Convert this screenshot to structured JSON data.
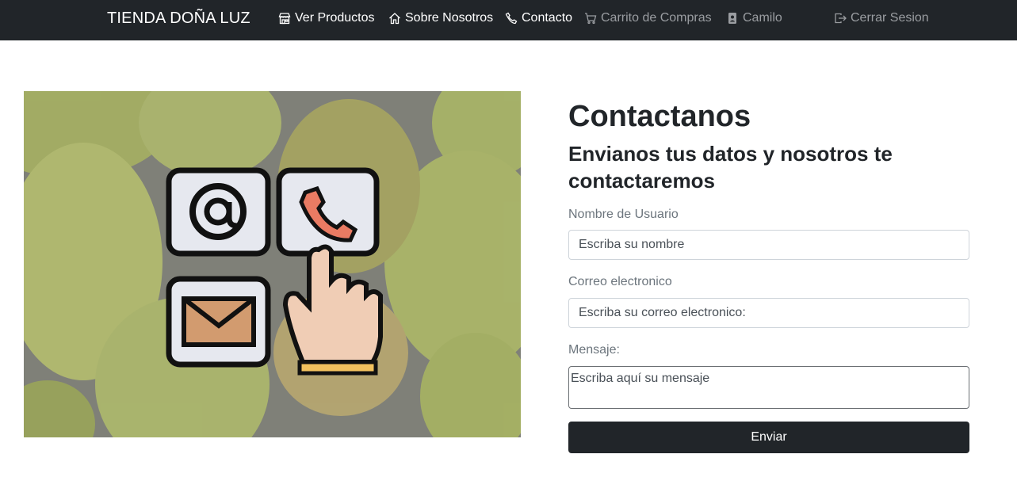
{
  "navbar": {
    "brand": "TIENDA DOÑA LUZ",
    "items": [
      {
        "label": "Ver Productos",
        "icon": "store-icon"
      },
      {
        "label": "Sobre Nosotros",
        "icon": "house-icon"
      },
      {
        "label": "Contacto",
        "icon": "phone-icon"
      },
      {
        "label": "Carrito de Compras",
        "icon": "cart-icon"
      },
      {
        "label": "Camilo",
        "icon": "person-badge-icon"
      },
      {
        "label": "Cerrar Sesion",
        "icon": "logout-icon"
      }
    ],
    "bg_color": "#212529",
    "muted_color": "#9a9da1"
  },
  "hero": {
    "icons": [
      "at-sign-icon",
      "phone-icon",
      "envelope-icon",
      "pointing-hand-icon"
    ]
  },
  "contact": {
    "title": "Contactanos",
    "subtitle": "Envianos tus datos y nosotros te contactaremos",
    "name_label": "Nombre de Usuario",
    "name_placeholder": "Escriba su nombre",
    "email_label": "Correo electronico",
    "email_placeholder": "Escriba su correo electronico:",
    "message_label": "Mensaje:",
    "message_placeholder": "Escriba aquí su mensaje",
    "submit_label": "Enviar"
  }
}
